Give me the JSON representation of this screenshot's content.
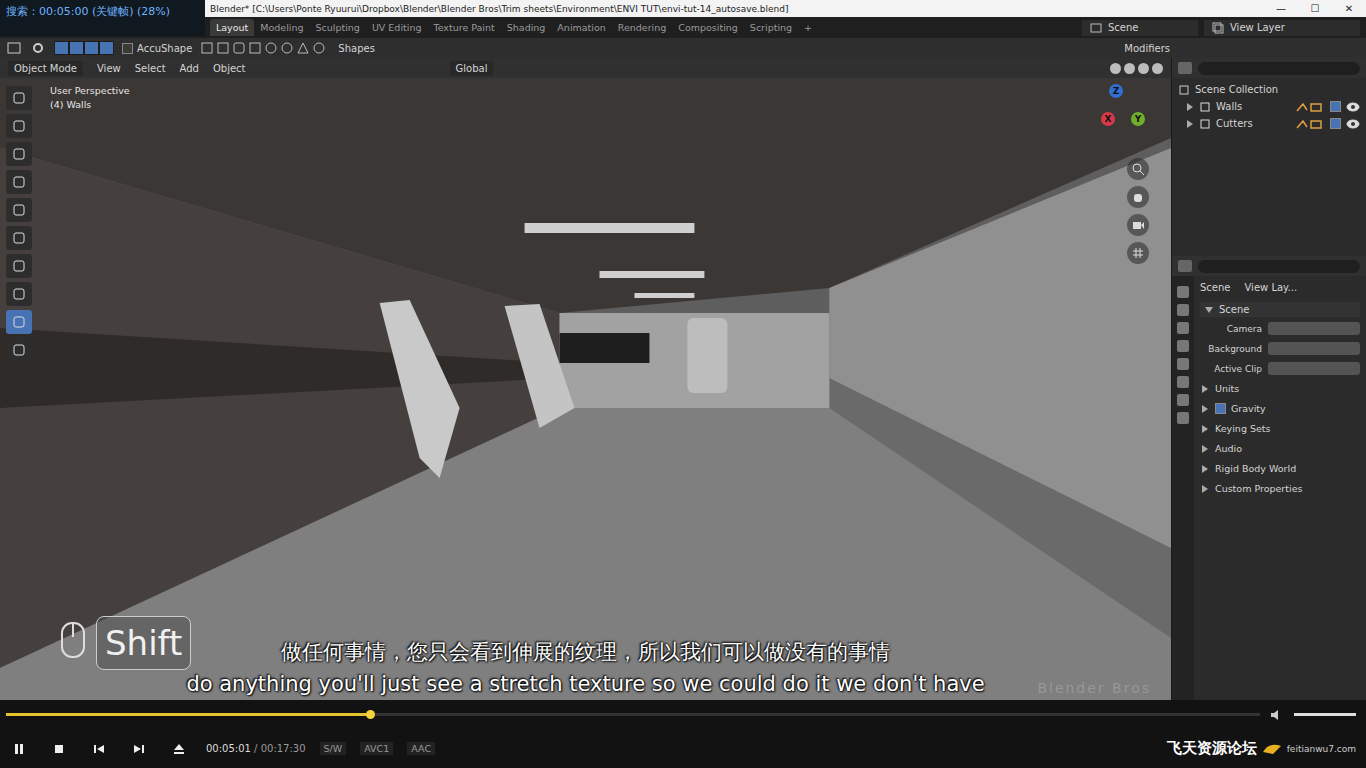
{
  "overlay": {
    "seek_info": "搜索：00:05:00 (关键帧) (28%)"
  },
  "blender": {
    "title": "Blender* [C:\\Users\\Ponte Ryuurui\\Dropbox\\Blender\\Blender Bros\\Trim sheets\\Environment\\ENVI TUT\\envi-tut-14_autosave.blend]",
    "window_controls": [
      "—",
      "☐",
      "✕"
    ],
    "workspaces": [
      {
        "label": "Layout",
        "selected": true
      },
      {
        "label": "Modeling",
        "selected": false
      },
      {
        "label": "Sculpting",
        "selected": false
      },
      {
        "label": "UV Editing",
        "selected": false
      },
      {
        "label": "Texture Paint",
        "selected": false
      },
      {
        "label": "Shading",
        "selected": false
      },
      {
        "label": "Animation",
        "selected": false
      },
      {
        "label": "Rendering",
        "selected": false
      },
      {
        "label": "Compositing",
        "selected": false
      },
      {
        "label": "Scripting",
        "selected": false
      }
    ],
    "add_workspace": "+",
    "scene": "Scene",
    "view_layer": "View Layer",
    "tool_header": {
      "snap": "AccuShape",
      "snap_checked": false,
      "shapes": "Shapes",
      "modifiers": "Modifiers"
    },
    "viewport_header": {
      "mode": "Object Mode",
      "menus": [
        "View",
        "Select",
        "Add",
        "Object"
      ],
      "orientation": "Global"
    },
    "viewport": {
      "view_name": "User Perspective",
      "collection": "(4) Walls",
      "gizmo_axes": [
        {
          "label": "Z",
          "color": "#2f6fd1"
        },
        {
          "label": "X",
          "color": "#d43a4a"
        },
        {
          "label": "Y",
          "color": "#6fae2c"
        }
      ]
    },
    "toolbar": [
      {
        "selected": false
      },
      {
        "selected": false
      },
      {
        "selected": false
      },
      {
        "selected": false
      },
      {
        "selected": false
      },
      {
        "selected": false
      },
      {
        "selected": false
      },
      {
        "selected": false
      },
      {
        "selected": true
      },
      {
        "selected": false
      }
    ],
    "outliner": {
      "root": "Scene Collection",
      "collections": [
        {
          "name": "Walls",
          "checked": true,
          "visible": true
        },
        {
          "name": "Cutters",
          "checked": true,
          "visible": true
        }
      ]
    },
    "properties": {
      "breadcrumbs": [
        "Scene",
        "View Lay..."
      ],
      "panel": "Scene",
      "fields": [
        "Camera",
        "Background",
        "Active Clip"
      ],
      "sections": [
        {
          "label": "Units",
          "kind": "section",
          "checked": false
        },
        {
          "label": "Gravity",
          "kind": "checkbox",
          "checked": true
        },
        {
          "label": "Keying Sets",
          "kind": "section",
          "checked": false
        },
        {
          "label": "Audio",
          "kind": "section",
          "checked": false
        },
        {
          "label": "Rigid Body World",
          "kind": "section",
          "checked": false
        },
        {
          "label": "Custom Properties",
          "kind": "section",
          "checked": false
        }
      ]
    }
  },
  "key_overlay": "Shift",
  "subtitles": {
    "zh": "做任何事情，您只会看到伸展的纹理，所以我们可以做没有的事情",
    "en": "do anything you'll just see a stretch texture so we could do it we don't have"
  },
  "watermark": "Blender Bros",
  "player": {
    "progress": 0.29,
    "time": "00:05:01",
    "separator": "/",
    "duration": "00:17:30",
    "badges": [
      "S/W",
      "AVC1",
      "AAC"
    ],
    "volume": 1,
    "site": "飞天资源论坛",
    "site_url": "feitianwu7.com"
  }
}
